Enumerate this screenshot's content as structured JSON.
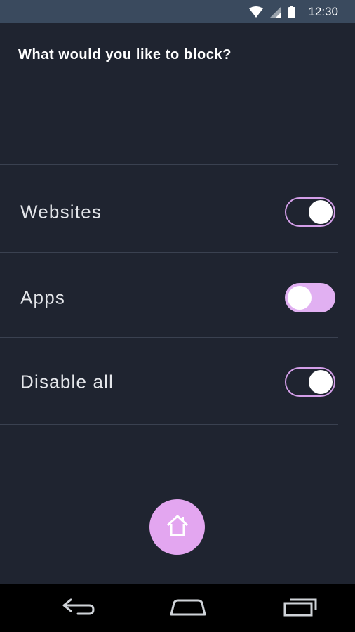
{
  "status_bar": {
    "time": "12:30",
    "icons": [
      "wifi-icon",
      "cell-signal-icon",
      "battery-icon"
    ]
  },
  "page": {
    "title": "What would you like to block?"
  },
  "options": [
    {
      "label": "Websites",
      "state": "on"
    },
    {
      "label": "Apps",
      "state": "off"
    },
    {
      "label": "Disable all",
      "state": "on"
    }
  ],
  "fab": {
    "icon": "home-icon"
  },
  "nav_bar": {
    "icons": [
      "back-icon",
      "home-nav-icon",
      "recent-apps-icon"
    ]
  },
  "colors": {
    "background": "#1f2430",
    "status_bar": "#3a4a5e",
    "accent": "#e3a6f0",
    "divider": "#3a4150"
  }
}
